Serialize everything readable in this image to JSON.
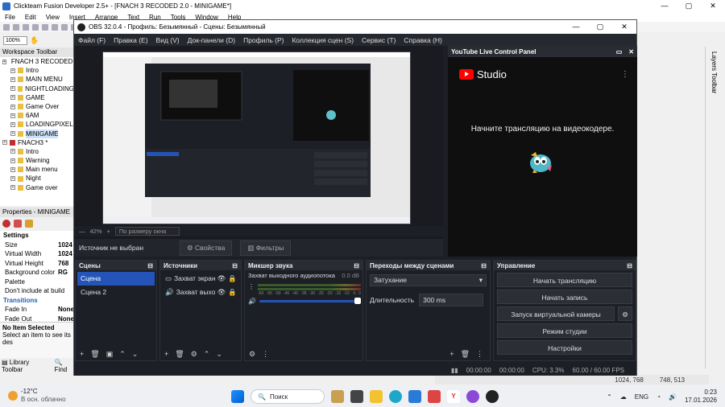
{
  "clickteam": {
    "title": "Clickteam Fusion Developer 2.5+ - [FNACH 3 RECODED 2.0 - MINIGAME*]",
    "menu": [
      "File",
      "Edit",
      "View",
      "Insert",
      "Arrange",
      "Text",
      "Run",
      "Tools",
      "Window",
      "Help"
    ],
    "zoom": "100%",
    "workspace_title": "Workspace Toolbar",
    "tree": [
      {
        "label": "FNACH 3 RECODED 2.0",
        "level": 0,
        "selected": false
      },
      {
        "label": "Intro",
        "level": 1,
        "selected": false
      },
      {
        "label": "MAIN MENU",
        "level": 1,
        "selected": false
      },
      {
        "label": "NIGHTLOADING",
        "level": 1,
        "selected": false
      },
      {
        "label": "GAME",
        "level": 1,
        "selected": false
      },
      {
        "label": "Game Over",
        "level": 1,
        "selected": false
      },
      {
        "label": "6AM",
        "level": 1,
        "selected": false
      },
      {
        "label": "LOADINGPIXEL",
        "level": 1,
        "selected": false
      },
      {
        "label": "MINIGAME",
        "level": 1,
        "selected": true
      },
      {
        "label": "FNACH3 *",
        "level": 0,
        "selected": false
      },
      {
        "label": "Intro",
        "level": 1,
        "selected": false
      },
      {
        "label": "Warning",
        "level": 1,
        "selected": false
      },
      {
        "label": "Main menu",
        "level": 1,
        "selected": false
      },
      {
        "label": "Night",
        "level": 1,
        "selected": false
      },
      {
        "label": "Game over",
        "level": 1,
        "selected": false
      }
    ],
    "properties_title": "Properties - MINIGAME",
    "properties": [
      {
        "key": "Settings",
        "value": "",
        "type": "hdr"
      },
      {
        "key": "Size",
        "value": "1024",
        "type": "row"
      },
      {
        "key": "Virtual Width",
        "value": "1024",
        "type": "row"
      },
      {
        "key": "Virtual Height",
        "value": "768",
        "type": "row"
      },
      {
        "key": "Background color",
        "value": "RG",
        "type": "row"
      },
      {
        "key": "Palette",
        "value": "",
        "type": "row"
      },
      {
        "key": "Don't include at build",
        "value": "",
        "type": "row"
      },
      {
        "key": "Transitions",
        "value": "",
        "type": "sec"
      },
      {
        "key": "Fade In",
        "value": "None",
        "type": "row"
      },
      {
        "key": "Fade Out",
        "value": "None",
        "type": "row"
      }
    ],
    "no_item_title": "No Item Selected",
    "no_item_desc": "Select an item to see its des",
    "library_label": "Library Toolbar",
    "find_label": "Find",
    "layers_label": "Layers Toolbar",
    "status_coords": "1024, 768",
    "status_mouse": "748, 513"
  },
  "obs": {
    "title": "OBS 32.0.4 - Профиль: Безымянный - Сцены: Безымянный",
    "menu": [
      "Файл (F)",
      "Правка (E)",
      "Вид (V)",
      "Док-панели (D)",
      "Профиль (P)",
      "Коллекция сцен (S)",
      "Сервис (T)",
      "Справка (H)"
    ],
    "zoom_label": "42%",
    "zoom_mode": "По размеру окна",
    "source_none": "Источник не выбран",
    "properties_btn": "Свойства",
    "filters_btn": "Фильтры",
    "youtube": {
      "panel_title": "YouTube Live Control Panel",
      "studio": "Studio",
      "message": "Начните трансляцию на видеокодере."
    },
    "scenes": {
      "title": "Сцены",
      "items": [
        "Сцена",
        "Сцена 2"
      ]
    },
    "sources": {
      "title": "Источники",
      "items": [
        "Захват экран",
        "Захват выход"
      ]
    },
    "mixer": {
      "title": "Микшер звука",
      "channel": "Захват выходного аудиопотока",
      "db": "0.0 dB",
      "ticks": [
        "-60",
        "-55",
        "-50",
        "-45",
        "-40",
        "-35",
        "-30",
        "-25",
        "-20",
        "-15",
        "-10",
        "-5",
        "0"
      ]
    },
    "transitions": {
      "title": "Переходы между сценами",
      "type": "Затухание",
      "duration_label": "Длительность",
      "duration": "300 ms"
    },
    "controls": {
      "title": "Управление",
      "buttons": [
        "Начать трансляцию",
        "Начать запись",
        "Запуск виртуальной камеры",
        "Режим студии",
        "Настройки"
      ]
    },
    "status": {
      "time1": "00:00:00",
      "time2": "00:00:00",
      "cpu": "CPU: 3.3%",
      "fps": "60.00 / 60.00 FPS"
    }
  },
  "taskbar": {
    "temp": "-12°C",
    "weather": "В осн. облачно",
    "search": "Поиск",
    "lang": "ENG",
    "time": "0:23",
    "date": "17.01.2026"
  }
}
